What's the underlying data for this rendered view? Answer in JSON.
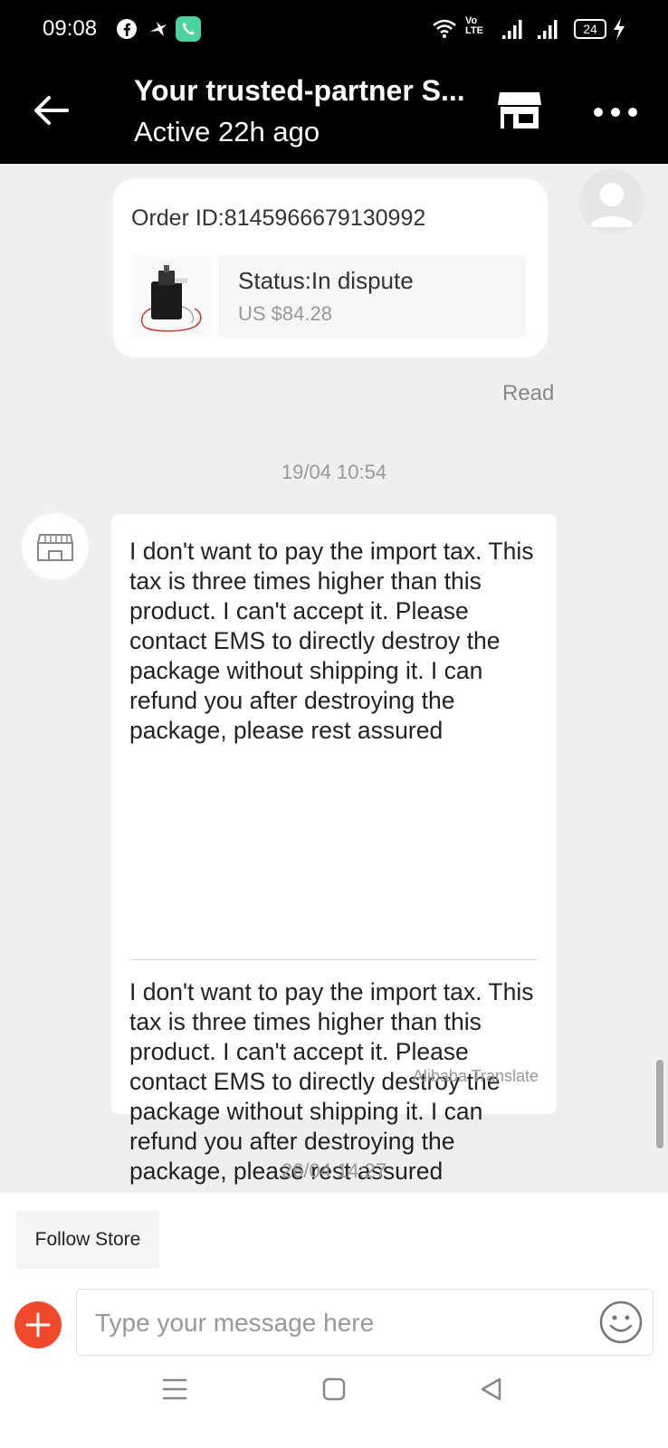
{
  "status_bar": {
    "time": "09:08",
    "icons": [
      "facebook-icon",
      "tweet-bird-icon",
      "whatsapp-phone-icon",
      "wifi-icon",
      "volte-icon",
      "signal-icon",
      "signal-icon",
      "battery-icon"
    ],
    "volte_top": "Vo",
    "volte_bottom": "LTE",
    "battery": "24"
  },
  "header": {
    "title": "Your trusted-partner S...",
    "subtitle": "Active 22h ago"
  },
  "order_card": {
    "order_id": "Order ID:8145966679130992",
    "status": "Status:In dispute",
    "price": "US $84.28"
  },
  "read_receipt": "Read",
  "timestamps": [
    "19/04 10:54",
    "26/04 14:27"
  ],
  "message": {
    "original": "I don't want to pay the import tax. This tax is three times higher than this product. I can't accept it. Please contact EMS to directly destroy the package without shipping it. I can refund you after destroying the package, please rest assured",
    "translated": "I don't want to pay the import tax. This tax is three times higher than this product. I can't accept it. Please contact EMS to directly destroy the package without shipping it. I can refund you after destroying the package, please rest assured",
    "translator_label": "Alibaba Translate"
  },
  "bottom_bar": {
    "follow_label": "Follow Store",
    "input_placeholder": "Type your message here",
    "input_value": ""
  },
  "colors": {
    "header_bg": "#000000",
    "chat_bg": "#efefef",
    "accent": "#f04a2d"
  }
}
